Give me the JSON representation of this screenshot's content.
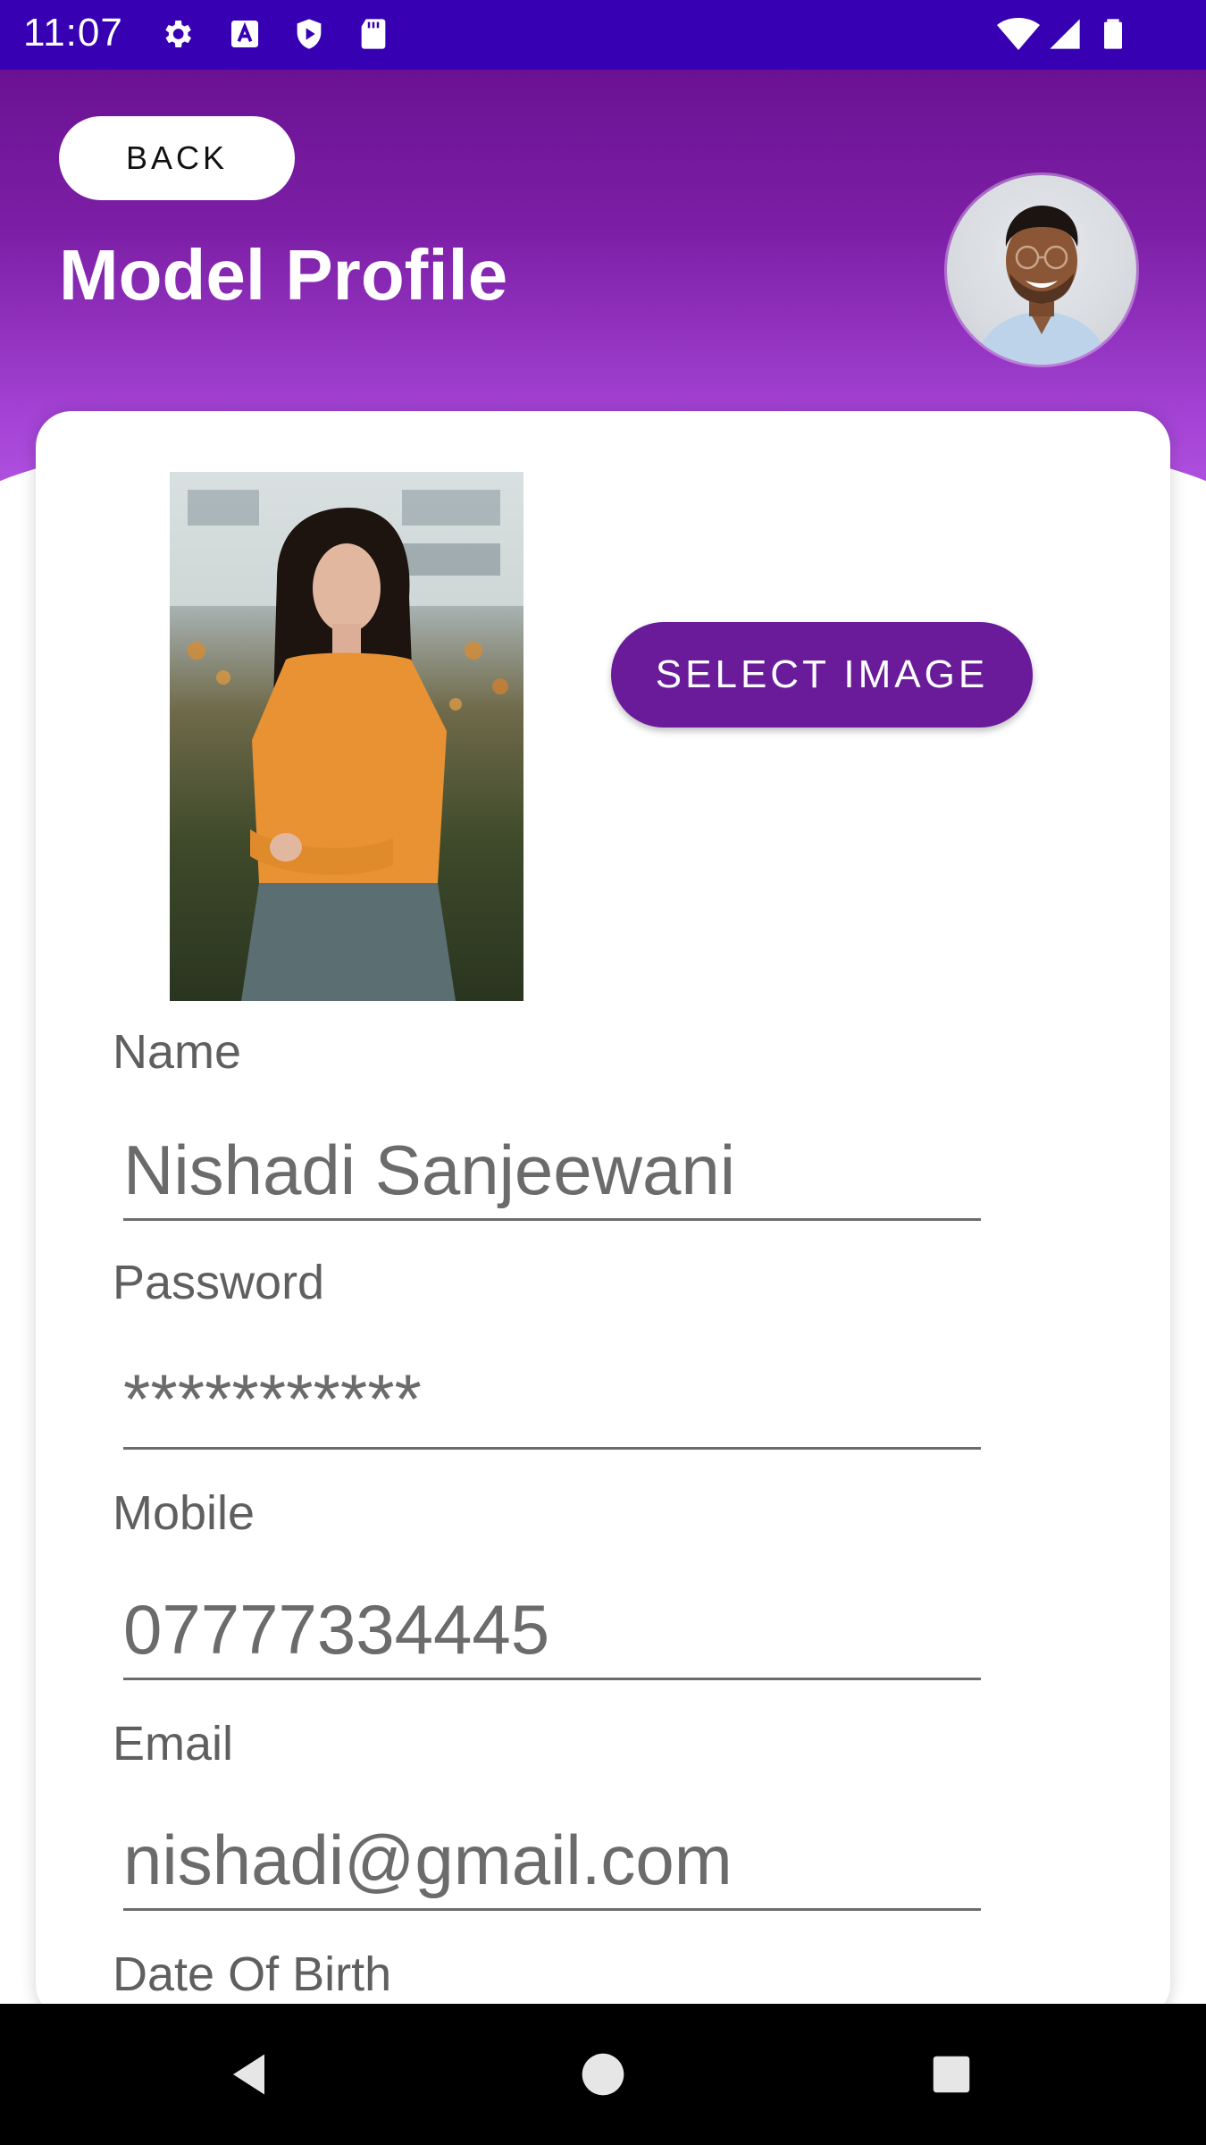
{
  "status_bar": {
    "time": "11:07",
    "icons_left": [
      "settings-icon",
      "a-letter-icon",
      "play-shield-icon",
      "sd-card-icon"
    ],
    "icons_right": [
      "wifi-icon",
      "cell-signal-icon",
      "battery-icon"
    ]
  },
  "header": {
    "back_label": "BACK",
    "title": "Model Profile",
    "colors": {
      "gradient_top": "#6a1293",
      "gradient_bottom": "#b85ae8"
    }
  },
  "card": {
    "select_image_label": "SELECT IMAGE",
    "fields": [
      {
        "label": "Name",
        "value": "Nishadi Sanjeewani"
      },
      {
        "label": "Password",
        "value": "***********"
      },
      {
        "label": "Mobile",
        "value": "07777334445"
      },
      {
        "label": "Email",
        "value": "nishadi@gmail.com"
      },
      {
        "label": "Date Of Birth",
        "value": ""
      }
    ]
  },
  "nav_bar": {
    "icons": [
      "back-triangle-icon",
      "home-circle-icon",
      "recents-square-icon"
    ]
  },
  "colors": {
    "accent": "#6a1b9a",
    "status_bar": "#3700b3"
  }
}
